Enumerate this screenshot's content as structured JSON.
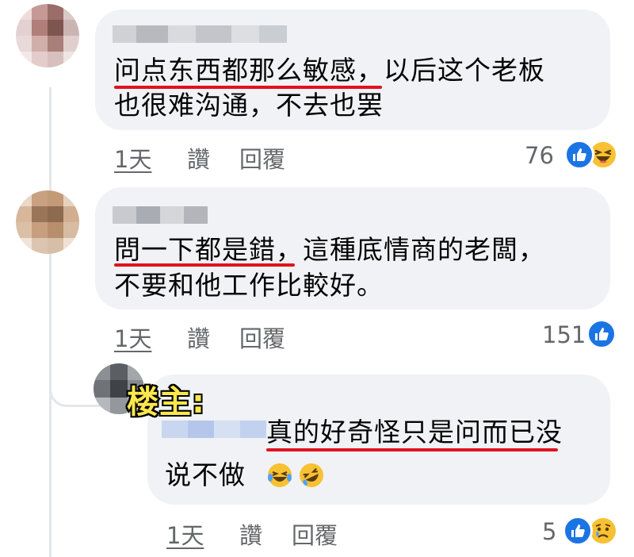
{
  "comments": [
    {
      "line1": "问点东西都那么敏感，以后这个老板",
      "line2": "也很难沟通，不去也罢",
      "time": "1天",
      "like": "讚",
      "reply": "回覆",
      "count": "76",
      "reactions": [
        "like-icon",
        "haha-icon"
      ]
    },
    {
      "line1": "問一下都是錯，這種底情商的老闆，",
      "line2": "不要和他工作比較好。",
      "time": "1天",
      "like": "讚",
      "reply": "回覆",
      "count": "151",
      "reactions": [
        "like-icon"
      ]
    }
  ],
  "reply_comment": {
    "tag": "楼主:",
    "line1": "真的好奇怪只是问而已没",
    "line2": "说不做",
    "emojis": [
      "crying-laughing-icon",
      "rofl-icon"
    ],
    "time": "1天",
    "like": "讚",
    "reply": "回覆",
    "count": "5",
    "reactions": [
      "like-icon",
      "sad-icon"
    ]
  },
  "colors": {
    "bubble": "#f0f2f5",
    "meta_text": "#65676b",
    "underline": "#e1121e",
    "like_blue": "#1b74e4",
    "tag_yellow": "#fde84b"
  }
}
